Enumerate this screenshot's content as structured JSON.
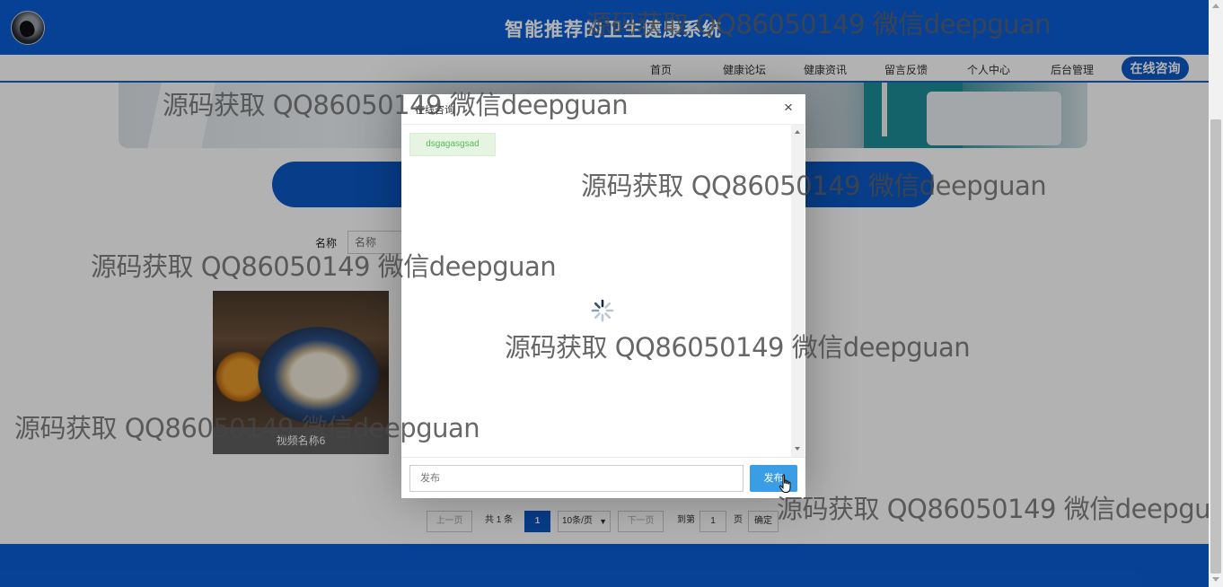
{
  "header": {
    "title": "智能推荐的卫生健康系统"
  },
  "nav": {
    "items": [
      "首页",
      "健康论坛",
      "健康资讯",
      "留言反馈",
      "个人中心",
      "后台管理"
    ],
    "consult": "在线咨询"
  },
  "search": {
    "label": "名称",
    "placeholder": "名称"
  },
  "video": {
    "caption": "视频名称6"
  },
  "pagination": {
    "prev": "上一页",
    "total": "共 1 条",
    "current": "1",
    "page_size": "10条/页",
    "next": "下一页",
    "goto_label": "到第",
    "goto_value": "1",
    "page_unit": "页",
    "confirm": "确定"
  },
  "dialog": {
    "title": "在线咨询",
    "close": "×",
    "messages": [
      "dsgagasgsad"
    ],
    "input_placeholder": "发布",
    "send_label": "发布"
  },
  "watermark": "源码获取 QQ86050149 微信deepguan",
  "colors": {
    "primary": "#0b5ed7",
    "accent": "#0b58c4",
    "send_button": "#3a9ee6",
    "bubble_bg": "#e6f5e1",
    "bubble_text": "#5cb85c"
  }
}
